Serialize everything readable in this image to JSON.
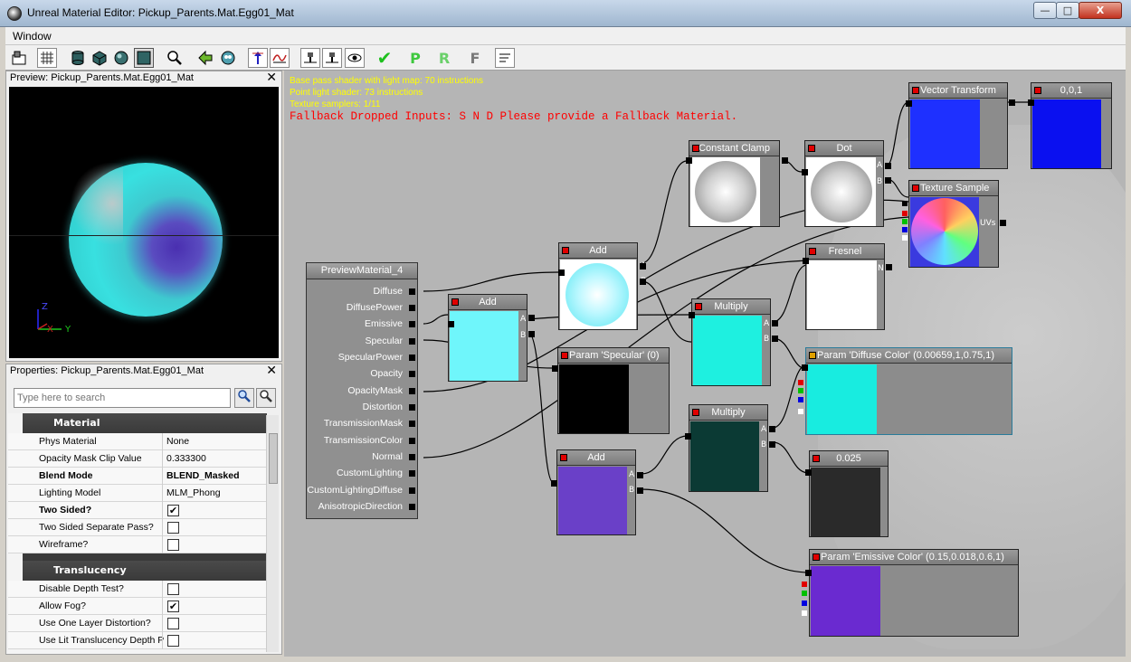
{
  "window": {
    "title": "Unreal Material Editor: Pickup_Parents.Mat.Egg01_Mat",
    "min_glyph": "—",
    "max_glyph": "□",
    "close_glyph": "X"
  },
  "menu": {
    "window_label": "Window"
  },
  "toolbar": {
    "icons": [
      "home-icon",
      "grid-icon",
      "cylinder-icon",
      "cube-icon",
      "sphere-icon",
      "plane-icon",
      "search-icon",
      "back-arrow-icon",
      "globe-icon",
      "pin-up-icon",
      "curve-icon",
      "pin-left-icon",
      "pin-right-icon",
      "eye-icon",
      "apply-icon",
      "p-icon",
      "r-icon",
      "f-icon",
      "notes-icon"
    ],
    "apply_glyph": "✔",
    "p_label": "P",
    "r_label": "R",
    "f_label": "F"
  },
  "preview": {
    "title": "Preview: Pickup_Parents.Mat.Egg01_Mat",
    "close_glyph": "✕",
    "axis_z": "Z",
    "axis_y": "Y",
    "axis_x": "X"
  },
  "properties": {
    "title": "Properties: Pickup_Parents.Mat.Egg01_Mat",
    "close_glyph": "✕",
    "search_placeholder": "Type here to search",
    "categories": [
      {
        "label": "Material",
        "rows": [
          {
            "name": "Phys Material",
            "value": "None",
            "bold": false
          },
          {
            "name": "Opacity Mask Clip Value",
            "value": "0.333300",
            "bold": false
          },
          {
            "name": "Blend Mode",
            "value": "BLEND_Masked",
            "bold": true
          },
          {
            "name": "Lighting Model",
            "value": "MLM_Phong",
            "bold": false
          },
          {
            "name": "Two Sided?",
            "checked": true,
            "bold": true
          },
          {
            "name": "Two Sided Separate Pass?",
            "checked": false,
            "bold": false
          },
          {
            "name": "Wireframe?",
            "checked": false,
            "bold": false
          }
        ]
      },
      {
        "label": "Translucency",
        "rows": [
          {
            "name": "Disable Depth Test?",
            "checked": false,
            "bold": false
          },
          {
            "name": "Allow Fog?",
            "checked": true,
            "bold": false
          },
          {
            "name": "Use One Layer Distortion?",
            "checked": false,
            "bold": false
          },
          {
            "name": "Use Lit Translucency Depth P",
            "checked": false,
            "bold": false
          }
        ]
      }
    ]
  },
  "canvas": {
    "stats": [
      "Base pass shader with light map: 70 instructions",
      "Point light shader: 73 instructions",
      "Texture samplers: 1/11"
    ],
    "fallback": "Fallback Dropped Inputs:  S N D  Please provide a Fallback Material.",
    "material_node": {
      "title": "PreviewMaterial_4",
      "inputs": [
        "Diffuse",
        "DiffusePower",
        "Emissive",
        "Specular",
        "SpecularPower",
        "Opacity",
        "OpacityMask",
        "Distortion",
        "TransmissionMask",
        "TransmissionColor",
        "Normal",
        "CustomLighting",
        "CustomLightingDiffuse",
        "AnisotropicDirection"
      ]
    },
    "nodes": {
      "add_top": {
        "title": "Add",
        "a": "A",
        "b": "B",
        "swatch": "#7ff0ff"
      },
      "add_mid": {
        "title": "Add",
        "a": "A",
        "b": "B",
        "swatch": "#6ff6fb"
      },
      "add_bottom": {
        "title": "Add",
        "a": "A",
        "b": "B",
        "swatch": "#6a40c8"
      },
      "constant_clamp": {
        "title": "Constant Clamp"
      },
      "dot": {
        "title": "Dot",
        "a": "A",
        "b": "B"
      },
      "vector_transform": {
        "title": "Vector Transform",
        "swatch": "#1e30ff"
      },
      "const_vec": {
        "title": "0,0,1",
        "swatch": "#0a10f0"
      },
      "texture_sample": {
        "title": "Texture Sample",
        "uvs": "UVs"
      },
      "fresnel": {
        "title": "Fresnel",
        "n": "N"
      },
      "multiply_top": {
        "title": "Multiply",
        "a": "A",
        "b": "B",
        "swatch": "#1ef0e0"
      },
      "multiply_bottom": {
        "title": "Multiply",
        "a": "A",
        "b": "B",
        "swatch": "#0b3a34"
      },
      "param_specular": {
        "title": "Param 'Specular' (0)",
        "swatch": "#000000"
      },
      "param_diffuse": {
        "title": "Param 'Diffuse Color' (0.00659,1,0.75,1)",
        "swatch": "#18ece0"
      },
      "const_025": {
        "title": "0.025",
        "swatch": "#2a2a2a"
      },
      "param_emissive": {
        "title": "Param 'Emissive Color' (0.15,0.018,0.6,1)",
        "swatch": "#6a2ad0"
      }
    }
  },
  "colors": {
    "accent_yellow": "#ffff00",
    "warning_red": "#ff0000",
    "node_header": "#8a8a8a",
    "canvas_bg": "#b5b5b5"
  }
}
